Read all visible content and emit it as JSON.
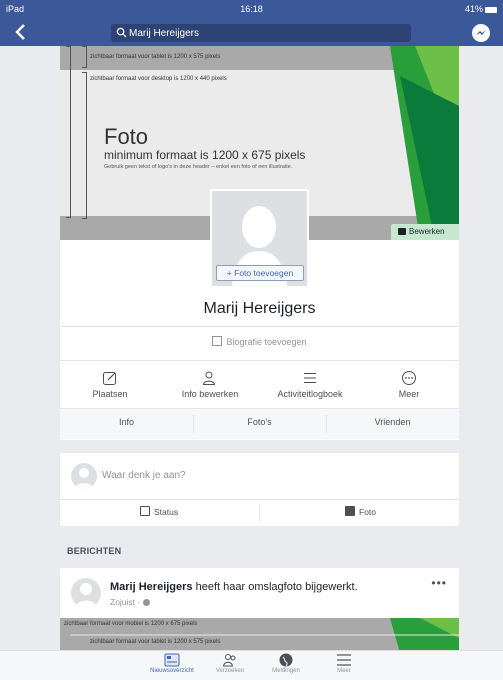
{
  "status_bar": {
    "device": "iPad",
    "time": "16:18",
    "battery": "41%"
  },
  "nav": {
    "search_value": "Marij Hereijgers"
  },
  "cover": {
    "note_tablet": "zichtbaar formaat voor tablet is 1200 x 575 pixels",
    "note_desktop": "zichtbaar formaat voor desktop is 1200 x 440 pixels",
    "title": "Foto",
    "subtitle": "minimum formaat is 1200 x 675 pixels",
    "hint": "Gebruik geen tekst of logo's in deze header – enkel een foto of een illustratie.",
    "edit_label": "Bewerken",
    "accent_colors": [
      "#2a9e3a",
      "#6cc04a",
      "#0b7a3a"
    ]
  },
  "profile": {
    "add_photo_label": "+ Foto toevoegen",
    "name": "Marij Hereijgers",
    "bio_label": "Biografie toevoegen"
  },
  "actions": [
    {
      "label": "Plaatsen",
      "icon": "edit-icon"
    },
    {
      "label": "Info bewerken",
      "icon": "person-edit-icon"
    },
    {
      "label": "Activiteitlogboek",
      "icon": "list-icon"
    },
    {
      "label": "Meer",
      "icon": "more-icon"
    }
  ],
  "subtabs": [
    "Info",
    "Foto's",
    "Vrienden"
  ],
  "composer": {
    "prompt": "Waar denk je aan?",
    "status_label": "Status",
    "photo_label": "Foto"
  },
  "section_heading": "BERICHTEN",
  "post": {
    "author": "Marij Hereijgers",
    "action": "heeft haar omslagfoto bijgewerkt.",
    "time": "Zojuist",
    "note_mobile": "zichtbaar formaat voor mobiel is 1200 x 675 pixels",
    "note_tablet": "zichtbaar formaat voor tablet is 1200 x 575 pixels"
  },
  "tabbar": [
    {
      "label": "Nieuwsoverzicht",
      "icon": "news-feed-icon",
      "active": true
    },
    {
      "label": "Verzoeken",
      "icon": "friend-requests-icon",
      "active": false
    },
    {
      "label": "Meldingen",
      "icon": "notifications-globe-icon",
      "active": false
    },
    {
      "label": "Meer",
      "icon": "menu-icon",
      "active": false
    }
  ],
  "colors": {
    "brand": "#3b5998",
    "link": "#4267b2",
    "background": "#e9ebee"
  }
}
